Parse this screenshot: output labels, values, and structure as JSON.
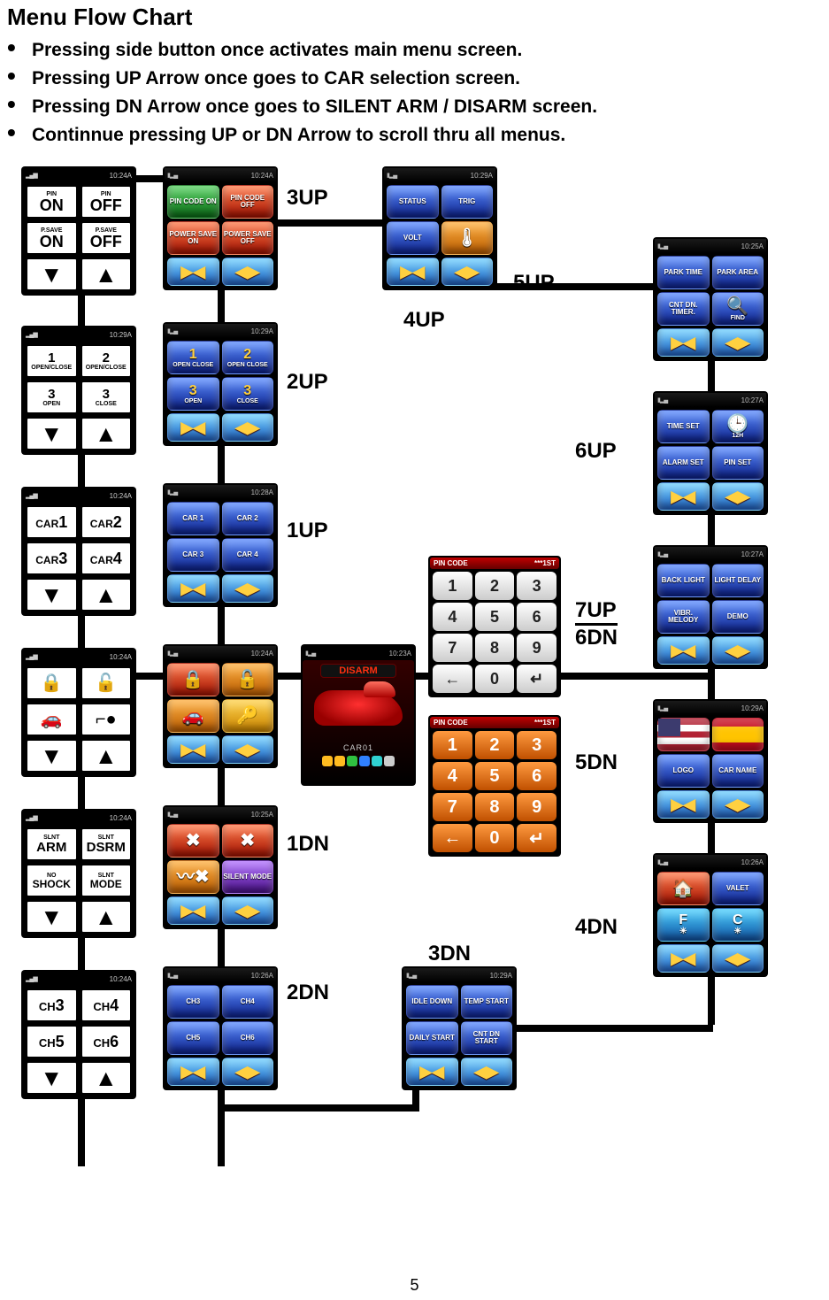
{
  "title": "Menu Flow Chart",
  "bullets": [
    "Pressing side button once activates main menu screen.",
    "Pressing UP Arrow once goes to CAR selection screen.",
    "Pressing DN Arrow once goes to SILENT ARM / DISARM screen.",
    "Continnue pressing UP or DN Arrow to scroll thru all menus."
  ],
  "labels": {
    "l3up": "3UP",
    "l2up": "2UP",
    "l1up": "1UP",
    "l4up": "4UP",
    "l5up": "5UP",
    "l6up": "6UP",
    "l7up": "7UP",
    "l6dn": "6DN",
    "l5dn": "5DN",
    "l4dn": "4DN",
    "l3dn": "3DN",
    "l2dn": "2DN",
    "l1dn": "1DN"
  },
  "status_time": "10:24A",
  "mono": {
    "c0": {
      "t": "10:24A",
      "a": [
        "PIN",
        "ON"
      ],
      "b": [
        "PIN",
        "OFF"
      ],
      "c": [
        "P.SAVE",
        "ON"
      ],
      "d": [
        "P.SAVE",
        "OFF"
      ]
    },
    "c1": {
      "t": "10:29A",
      "a": [
        "1",
        "OPEN/CLOSE"
      ],
      "b": [
        "2",
        "OPEN/CLOSE"
      ],
      "c": [
        "3 OPEN",
        ""
      ],
      "d": [
        "3 CLOSE",
        ""
      ]
    },
    "c2": {
      "t": "10:24A",
      "a": [
        "CAR",
        "1"
      ],
      "b": [
        "CAR",
        "2"
      ],
      "c": [
        "CAR",
        "3"
      ],
      "d": [
        "CAR",
        "4"
      ]
    },
    "c3": {
      "t": "10:24A",
      "a": "lock",
      "b": "unlock",
      "c": "car",
      "d": "key"
    },
    "c4": {
      "t": "10:24A",
      "a": [
        "SLNT",
        "ARM"
      ],
      "b": [
        "SLNT",
        "DSRM"
      ],
      "c": [
        "NO",
        "SHOCK"
      ],
      "d": [
        "SLNT",
        "MODE"
      ]
    },
    "c5": {
      "t": "10:24A",
      "a": [
        "CH",
        "3"
      ],
      "b": [
        "CH",
        "4"
      ],
      "c": [
        "CH",
        "5"
      ],
      "d": [
        "CH",
        "6"
      ]
    }
  },
  "color": {
    "s3up": {
      "t": "10:24A",
      "tiles": [
        [
          "PIN CODE ON",
          "green"
        ],
        [
          "PIN CODE OFF",
          "red"
        ],
        [
          "POWER SAVE ON",
          "red"
        ],
        [
          "POWER SAVE OFF",
          "red"
        ]
      ]
    },
    "s2up": {
      "t": "10:29A",
      "tiles": [
        [
          "1 OPEN CLOSE",
          "blue"
        ],
        [
          "2 OPEN CLOSE",
          "blue"
        ],
        [
          "3 OPEN",
          "blue"
        ],
        [
          "3 CLOSE",
          "blue"
        ]
      ]
    },
    "s1up": {
      "t": "10:28A",
      "tiles": [
        [
          "CAR 1",
          "blue"
        ],
        [
          "CAR 2",
          "blue"
        ],
        [
          "CAR 3",
          "blue"
        ],
        [
          "CAR 4",
          "blue"
        ]
      ]
    },
    "main": {
      "t": "10:24A",
      "tiles": [
        [
          "lock",
          "red"
        ],
        [
          "unlock",
          "orange"
        ],
        [
          "car",
          "orange"
        ],
        [
          "key",
          "gold"
        ]
      ]
    },
    "s1dn": {
      "t": "10:25A",
      "tiles": [
        [
          "X",
          "red"
        ],
        [
          "X",
          "red"
        ],
        [
          "X",
          "orange"
        ],
        [
          "SILENT MODE",
          "purple"
        ]
      ]
    },
    "s2dn": {
      "t": "10:26A",
      "tiles": [
        [
          "CH3",
          "blue"
        ],
        [
          "CH4",
          "blue"
        ],
        [
          "CH5",
          "blue"
        ],
        [
          "CH6",
          "blue"
        ]
      ]
    },
    "s4up": {
      "t": "10:29A",
      "tiles": [
        [
          "STATUS",
          "blue"
        ],
        [
          "TRIG",
          "blue"
        ],
        [
          "VOLT",
          "blue"
        ],
        [
          "temp",
          "orange"
        ]
      ]
    },
    "s3dn": {
      "t": "10:29A",
      "tiles": [
        [
          "IDLE DOWN",
          "blue"
        ],
        [
          "TEMP START",
          "blue"
        ],
        [
          "DAILY START",
          "blue"
        ],
        [
          "CNT DN START",
          "blue"
        ]
      ]
    },
    "r5up": {
      "t": "10:25A",
      "tiles": [
        [
          "PARK TIME",
          "blue"
        ],
        [
          "PARK AREA",
          "blue"
        ],
        [
          "CNT DN. TIMER.",
          "blue"
        ],
        [
          "FIND",
          "blue"
        ]
      ]
    },
    "r6up": {
      "t": "10:27A",
      "tiles": [
        [
          "TIME SET",
          "blue"
        ],
        [
          "12H",
          "blue"
        ],
        [
          "ALARM SET",
          "blue"
        ],
        [
          "PIN SET",
          "blue"
        ]
      ]
    },
    "r7up": {
      "t": "10:27A",
      "tiles": [
        [
          "BACK LIGHT",
          "blue"
        ],
        [
          "LIGHT DELAY",
          "blue"
        ],
        [
          "VIBR. MELODY",
          "blue"
        ],
        [
          "DEMO",
          "blue"
        ]
      ]
    },
    "r5dn": {
      "t": "10:29A",
      "tiles": [
        [
          "flag-us",
          ""
        ],
        [
          "flag-es",
          ""
        ],
        [
          "LOGO",
          "blue"
        ],
        [
          "CAR NAME",
          "blue"
        ]
      ]
    },
    "r4dn": {
      "t": "10:26A",
      "tiles": [
        [
          "house",
          "red"
        ],
        [
          "VALET",
          "blue"
        ],
        [
          "F°",
          "cyan"
        ],
        [
          "C°",
          "cyan"
        ]
      ]
    }
  },
  "car": {
    "t": "10:23A",
    "disarm": "DISARM",
    "name": "CAR01"
  },
  "keypad": {
    "hdr_l": "PIN CODE",
    "hdr_r": "***1ST",
    "keys": [
      "1",
      "2",
      "3",
      "4",
      "5",
      "6",
      "7",
      "8",
      "9",
      "←",
      "0",
      "↵"
    ]
  },
  "pagenum": "5"
}
